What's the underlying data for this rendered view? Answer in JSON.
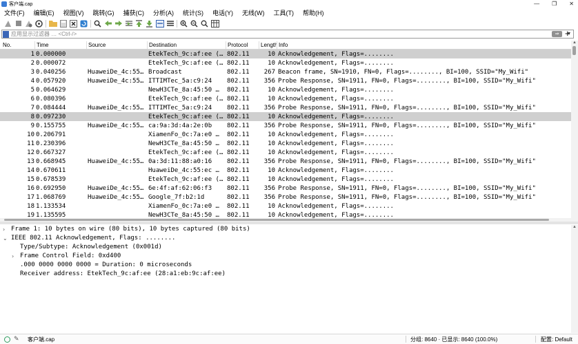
{
  "window": {
    "title": "客户端.cap",
    "controls": [
      "—",
      "❐",
      "✕"
    ]
  },
  "menu": [
    "文件(F)",
    "编辑(E)",
    "视图(V)",
    "跳转(G)",
    "捕获(C)",
    "分析(A)",
    "统计(S)",
    "电话(Y)",
    "无线(W)",
    "工具(T)",
    "帮助(H)"
  ],
  "toolbar": {
    "icons": [
      "shark-fin-start-icon",
      "stop-icon",
      "restart-icon",
      "options-icon",
      "open-icon",
      "save-icon",
      "close-file-icon",
      "reload-icon",
      "find-icon",
      "go-back-icon",
      "go-forward-icon",
      "go-to-packet-icon",
      "first-packet-icon",
      "last-packet-icon",
      "autoscroll-icon",
      "colorize-icon",
      "zoom-in-icon",
      "zoom-out-icon",
      "normal-size-icon",
      "resize-columns-icon"
    ]
  },
  "filter": {
    "placeholder": "应用显示过滤器 … <Ctrl-/>",
    "apply_glyph": "⇒",
    "dropdown_glyph": "▾",
    "add_glyph": "+"
  },
  "packet_list": {
    "columns": [
      "No.",
      "Time",
      "Source",
      "Destination",
      "Protocol",
      "Length",
      "Info"
    ],
    "selected_row": 0,
    "highlight_rows": [
      0,
      7
    ],
    "rows": [
      {
        "no": "1",
        "time": "0.000000",
        "src": "",
        "dst": "EtekTech_9c:af:ee (…",
        "proto": "802.11",
        "len": "10",
        "info": "Acknowledgement, Flags=........"
      },
      {
        "no": "2",
        "time": "0.000072",
        "src": "",
        "dst": "EtekTech_9c:af:ee (…",
        "proto": "802.11",
        "len": "10",
        "info": "Acknowledgement, Flags=........"
      },
      {
        "no": "3",
        "time": "0.040256",
        "src": "HuaweiDe_4c:55…",
        "dst": "Broadcast",
        "proto": "802.11",
        "len": "267",
        "info": "Beacon frame, SN=1910, FN=0, Flags=........, BI=100, SSID=\"My_Wifi\""
      },
      {
        "no": "4",
        "time": "0.057920",
        "src": "HuaweiDe_4c:55…",
        "dst": "ITTIMTec_5a:c9:24",
        "proto": "802.11",
        "len": "356",
        "info": "Probe Response, SN=1911, FN=0, Flags=........, BI=100, SSID=\"My_Wifi\""
      },
      {
        "no": "5",
        "time": "0.064629",
        "src": "",
        "dst": "NewH3CTe_8a:45:50 …",
        "proto": "802.11",
        "len": "10",
        "info": "Acknowledgement, Flags=........"
      },
      {
        "no": "6",
        "time": "0.080396",
        "src": "",
        "dst": "EtekTech_9c:af:ee (…",
        "proto": "802.11",
        "len": "10",
        "info": "Acknowledgement, Flags=........"
      },
      {
        "no": "7",
        "time": "0.084444",
        "src": "HuaweiDe_4c:55…",
        "dst": "ITTIMTec_5a:c9:24",
        "proto": "802.11",
        "len": "356",
        "info": "Probe Response, SN=1911, FN=0, Flags=........, BI=100, SSID=\"My_Wifi\""
      },
      {
        "no": "8",
        "time": "0.097230",
        "src": "",
        "dst": "EtekTech_9c:af:ee (…",
        "proto": "802.11",
        "len": "10",
        "info": "Acknowledgement, Flags=........"
      },
      {
        "no": "9",
        "time": "0.155755",
        "src": "HuaweiDe_4c:55…",
        "dst": "ca:9a:3d:4a:2e:0b",
        "proto": "802.11",
        "len": "356",
        "info": "Probe Response, SN=1911, FN=0, Flags=........, BI=100, SSID=\"My_Wifi\""
      },
      {
        "no": "10",
        "time": "0.206791",
        "src": "",
        "dst": "XiamenFo_0c:7a:e0 …",
        "proto": "802.11",
        "len": "10",
        "info": "Acknowledgement, Flags=........"
      },
      {
        "no": "11",
        "time": "0.230396",
        "src": "",
        "dst": "NewH3CTe_8a:45:50 …",
        "proto": "802.11",
        "len": "10",
        "info": "Acknowledgement, Flags=........"
      },
      {
        "no": "12",
        "time": "0.667327",
        "src": "",
        "dst": "EtekTech_9c:af:ee (…",
        "proto": "802.11",
        "len": "10",
        "info": "Acknowledgement, Flags=........"
      },
      {
        "no": "13",
        "time": "0.668945",
        "src": "HuaweiDe_4c:55…",
        "dst": "0a:3d:11:88:a0:16",
        "proto": "802.11",
        "len": "356",
        "info": "Probe Response, SN=1911, FN=0, Flags=........, BI=100, SSID=\"My_Wifi\""
      },
      {
        "no": "14",
        "time": "0.670611",
        "src": "",
        "dst": "HuaweiDe_4c:55:ec …",
        "proto": "802.11",
        "len": "10",
        "info": "Acknowledgement, Flags=........"
      },
      {
        "no": "15",
        "time": "0.678539",
        "src": "",
        "dst": "EtekTech_9c:af:ee (…",
        "proto": "802.11",
        "len": "10",
        "info": "Acknowledgement, Flags=........"
      },
      {
        "no": "16",
        "time": "0.692950",
        "src": "HuaweiDe_4c:55…",
        "dst": "6e:4f:af:62:06:f3",
        "proto": "802.11",
        "len": "356",
        "info": "Probe Response, SN=1911, FN=0, Flags=........, BI=100, SSID=\"My_Wifi\""
      },
      {
        "no": "17",
        "time": "1.068769",
        "src": "HuaweiDe_4c:55…",
        "dst": "Google_7f:b2:1d",
        "proto": "802.11",
        "len": "356",
        "info": "Probe Response, SN=1911, FN=0, Flags=........, BI=100, SSID=\"My_Wifi\""
      },
      {
        "no": "18",
        "time": "1.133534",
        "src": "",
        "dst": "XiamenFo_0c:7a:e0 …",
        "proto": "802.11",
        "len": "10",
        "info": "Acknowledgement, Flags=........"
      },
      {
        "no": "19",
        "time": "1.135595",
        "src": "",
        "dst": "NewH3CTe_8a:45:50 …",
        "proto": "802.11",
        "len": "10",
        "info": "Acknowledgement, Flags=........"
      }
    ]
  },
  "details": [
    {
      "indent": 0,
      "arrow": "›",
      "text": "Frame 1: 10 bytes on wire (80 bits), 10 bytes captured (80 bits)"
    },
    {
      "indent": 0,
      "arrow": "⌄",
      "text": "IEEE 802.11 Acknowledgement, Flags: ........"
    },
    {
      "indent": 1,
      "arrow": "",
      "text": "Type/Subtype: Acknowledgement (0x001d)"
    },
    {
      "indent": 1,
      "arrow": "›",
      "text": "Frame Control Field: 0xd400"
    },
    {
      "indent": 1,
      "arrow": "",
      "text": ".000 0000 0000 0000 = Duration: 0 microseconds"
    },
    {
      "indent": 1,
      "arrow": "",
      "text": "Receiver address: EtekTech_9c:af:ee (28:a1:eb:9c:af:ee)"
    }
  ],
  "status": {
    "file": "客户端.cap",
    "packets": "分组: 8640 · 已显示: 8640 (100.0%)",
    "profile": "配置: Default"
  },
  "colors": {
    "selected_row": "#cfcfcf",
    "bookmark": "#3b66b7",
    "ready_indicator": "#2f9e60"
  }
}
